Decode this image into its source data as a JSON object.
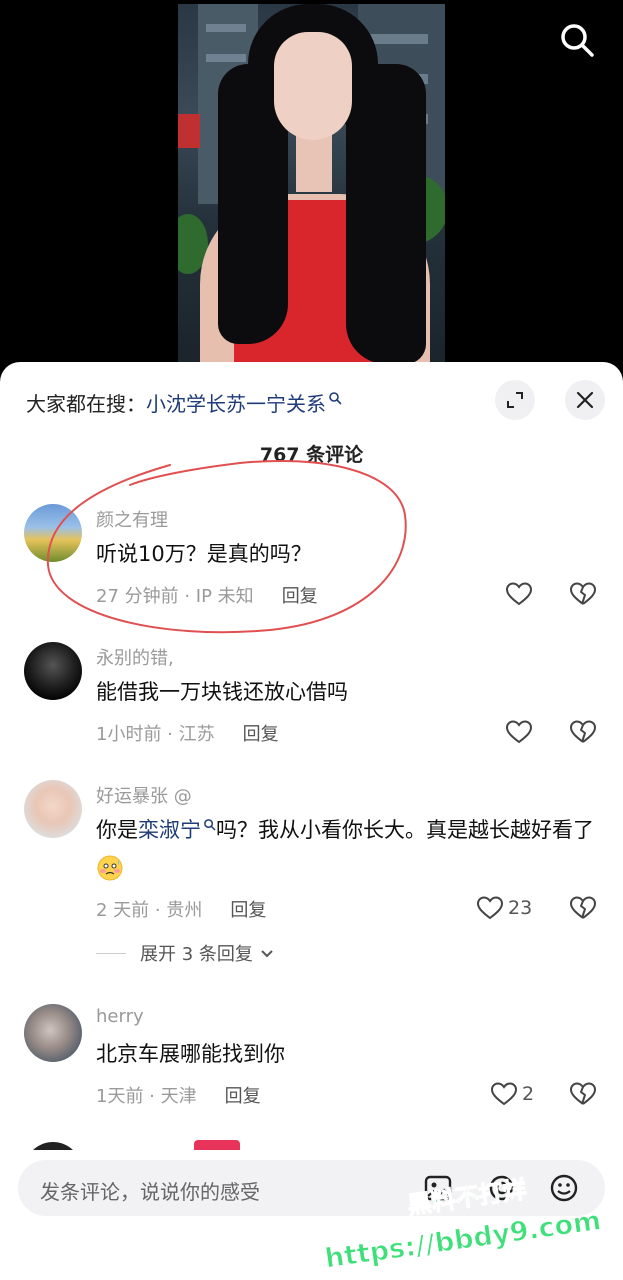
{
  "header": {
    "search_icon": "search-icon"
  },
  "sheet": {
    "search_prefix": "大家都在搜：",
    "search_term": "小沈学长苏一宁关系",
    "comment_count": "767 条评论",
    "icons": {
      "expand": "expand-icon",
      "close": "close-icon"
    }
  },
  "comments": [
    {
      "name": "颜之有理",
      "text": "听说10万？是真的吗？",
      "time": "27 分钟前 · IP 未知",
      "reply": "回复",
      "likes": ""
    },
    {
      "name": "永别的错,",
      "text": "能借我一万块钱还放心借吗",
      "time": "1小时前 · 江苏",
      "reply": "回复",
      "likes": ""
    },
    {
      "name": "好运暴张 @",
      "text_before": "你是",
      "mention": "栾淑宁",
      "text_after": "吗？我从小看你长大。真是越长越好看了",
      "time": "2 天前 · 贵州",
      "reply": "回复",
      "likes": "23",
      "expand_replies": "展开 3 条回复"
    },
    {
      "name": "herry",
      "text": "北京车展哪能找到你",
      "time": "1天前 · 天津",
      "reply": "回复",
      "likes": "2"
    }
  ],
  "input": {
    "placeholder": "发条评论，说说你的感受",
    "icons": [
      "image-icon",
      "at-icon",
      "emoji-icon"
    ]
  },
  "watermark": {
    "line1": "黑料不打烊",
    "line2": "https://bbdy9.com"
  },
  "colors": {
    "link": "#1f3c78",
    "annotation_red": "#e05050",
    "watermark_green": "#3fe07a"
  }
}
